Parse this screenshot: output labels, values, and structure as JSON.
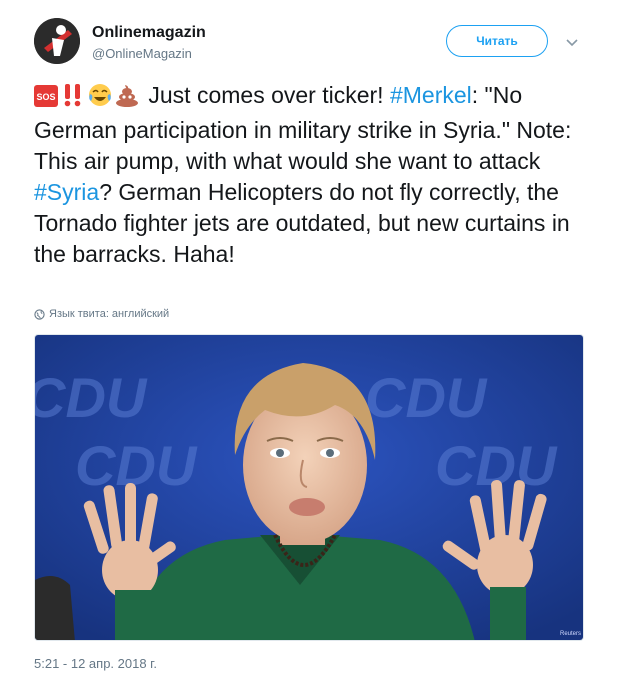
{
  "account": {
    "name": "Onlinemagazin",
    "handle": "@OnlineMagazin",
    "follow_label": "Читать"
  },
  "tweet": {
    "emojis": [
      "sos",
      "double-exclamation",
      "tears-of-joy",
      "pile-of-poo"
    ],
    "text_parts": {
      "p1": " Just comes over ticker! ",
      "hashtag1": "#Merkel",
      "p2": ": \"No German participation in military strike in Syria.\" Note: This air pump, with what would she want to attack ",
      "hashtag2": "#Syria",
      "p3": "? German Helicopters do not fly correctly, the Tornado fighter jets are outdated, but new curtains in the barracks. Haha!"
    },
    "language_label": "Язык твита: английский",
    "timestamp": "5:21 - 12 апр. 2018 г."
  },
  "media": {
    "background_words": [
      "CDU",
      "CDU",
      "CDU",
      "CDU"
    ],
    "watermark": "Reuters",
    "colors": {
      "background": "#1f3f9a",
      "jacket": "#1f6a45"
    }
  }
}
